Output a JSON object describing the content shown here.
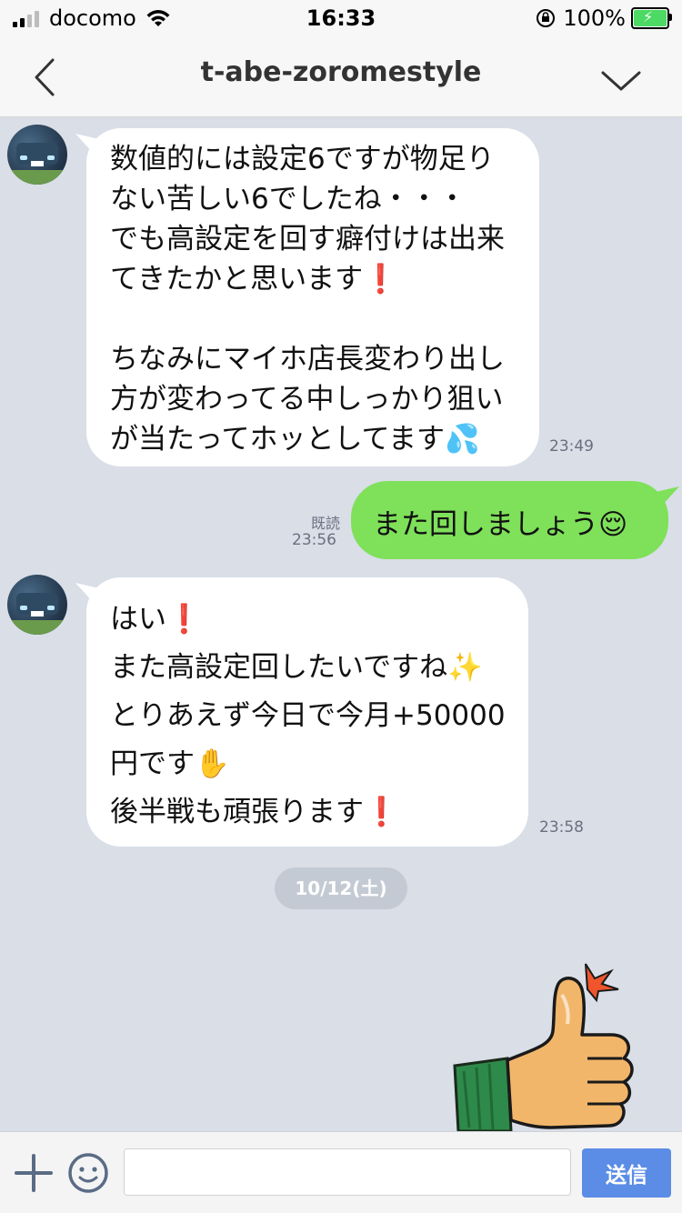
{
  "status_bar": {
    "carrier": "docomo",
    "time": "16:33",
    "battery": "100%"
  },
  "header": {
    "title": "t-abe-zoromestyle"
  },
  "messages": [
    {
      "direction": "in",
      "lines": [
        "数値的には設定6ですが物足り",
        "ない苦しい6でしたね・・・",
        "でも高設定を回す癖付けは出来",
        "てきたかと思います❗",
        "",
        "ちなみにマイホ店長変わり出し",
        "方が変わってる中しっかり狙い",
        "が当たってホッとしてます💦"
      ],
      "time": "23:49"
    },
    {
      "direction": "out",
      "text": "また回しましょう😌",
      "read_label": "既読",
      "time": "23:56"
    },
    {
      "direction": "in",
      "lines": [
        "はい❗",
        "また高設定回したいですね✨",
        "とりあえず今日で今月+50000",
        "円です✋",
        "後半戦も頑張ります❗"
      ],
      "time": "23:58"
    }
  ],
  "date_divider": "10/12(土)",
  "sticker": "thumbs-up-sticker",
  "input": {
    "placeholder": "",
    "value": "",
    "send_label": "送信"
  },
  "colors": {
    "chat_background": "#d9dee7",
    "outgoing_bubble": "#7fe05a",
    "incoming_bubble": "#ffffff",
    "send_button": "#5b8de6"
  }
}
